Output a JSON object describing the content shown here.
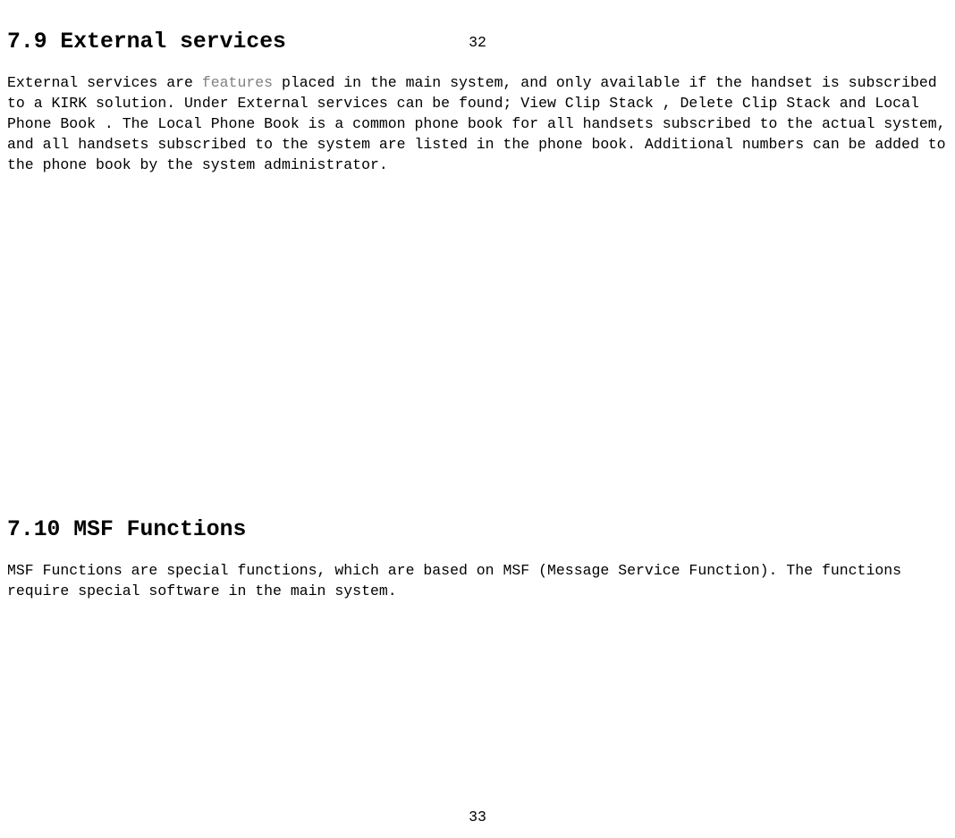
{
  "page": {
    "numberTop": "32",
    "numberBottom": "33"
  },
  "sections": {
    "external": {
      "heading": "7.9 External services",
      "p1a": "External services are ",
      "p1b_muted": "features",
      "p1c": " placed in the main system, and only available if the handset is subscribed to a KIRK solution. Under External services can be found;  View Clip Stack ,  Delete Clip Stack  and  Local Phone Book . The Local Phone Book is a common phone book for all handsets subscribed to the actual system, and all handsets subscribed to the system are listed in the phone book. Additional numbers can be added to the phone book by the system administrator."
    },
    "msf": {
      "heading": "7.10 MSF Functions",
      "p1": "MSF Functions are special functions, which are based on MSF (Message Service Function). The functions require special software in the main system."
    }
  }
}
